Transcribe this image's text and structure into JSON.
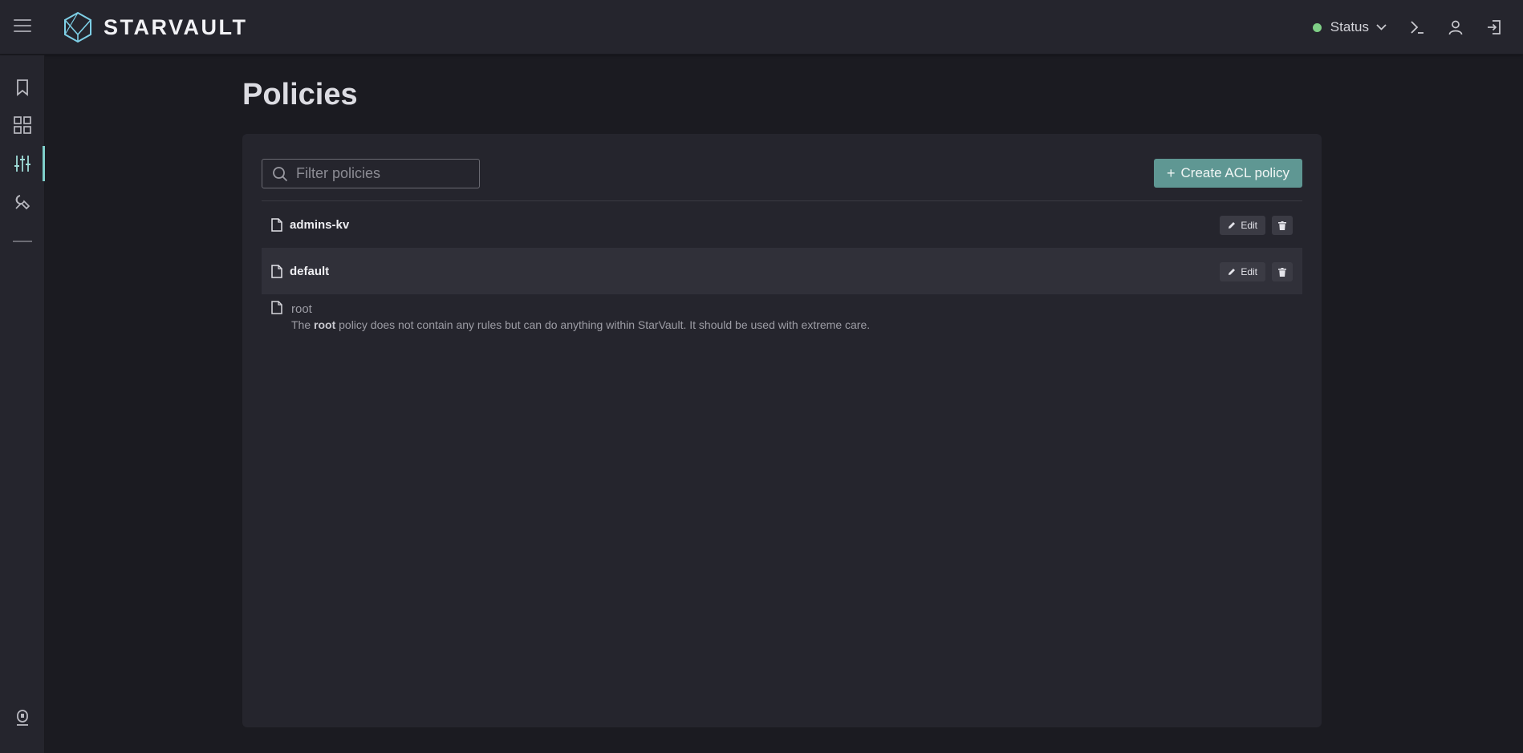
{
  "app": {
    "brand": "STARVAULT"
  },
  "header": {
    "status_label": "Status",
    "status_color": "#7fcf86",
    "icons": [
      "terminal-icon",
      "user-icon",
      "logout-icon"
    ]
  },
  "sidebar": {
    "items": [
      {
        "icon": "bookmark-icon"
      },
      {
        "icon": "grid-icon"
      },
      {
        "icon": "sliders-icon",
        "active": true
      },
      {
        "icon": "tools-icon"
      }
    ],
    "bottom_icon": "lock-icon",
    "accent": "#7ecfca"
  },
  "page": {
    "title": "Policies"
  },
  "toolbar": {
    "filter_placeholder": "Filter policies",
    "create_label": "Create ACL policy",
    "create_color": "#5f9793"
  },
  "policies": [
    {
      "name": "admins-kv",
      "edit_label": "Edit"
    },
    {
      "name": "default",
      "edit_label": "Edit"
    }
  ],
  "root": {
    "name": "root",
    "desc_prefix": "The",
    "desc_bold": "root",
    "desc_suffix": "policy does not contain any rules but can do anything within StarVault. It should be used with extreme care."
  }
}
